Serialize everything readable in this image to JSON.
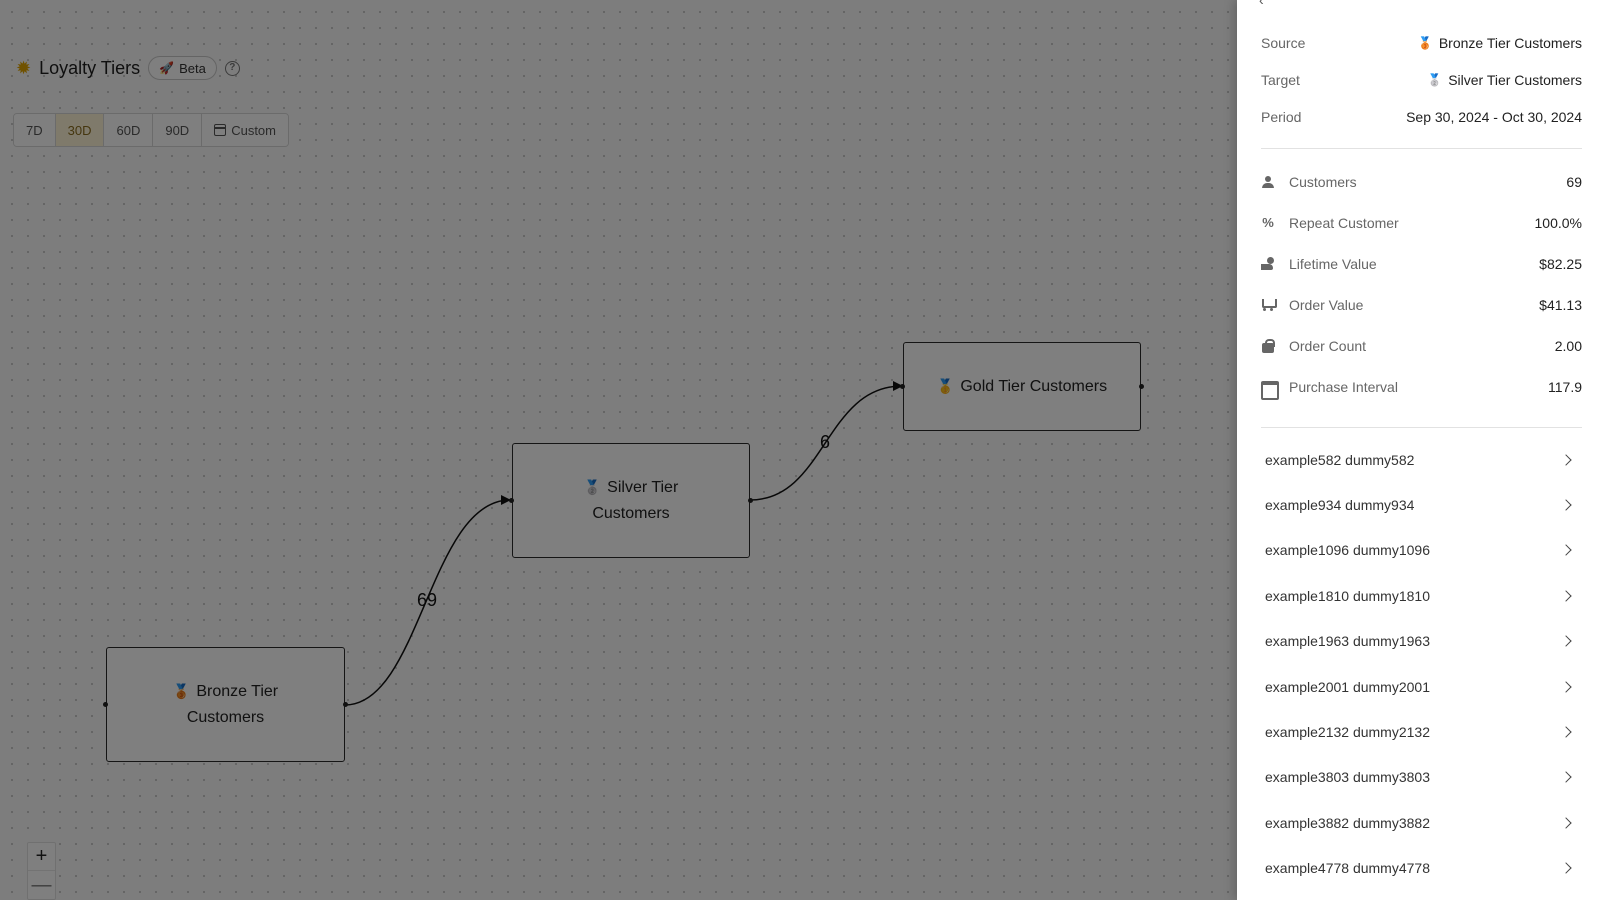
{
  "header": {
    "title": "Loyalty Tiers",
    "app_icon": "sun-icon",
    "badge_label": "Beta",
    "badge_icon": "rocket-icon",
    "help_icon": "help-circle-icon"
  },
  "periods": [
    {
      "label": "7D",
      "active": false
    },
    {
      "label": "30D",
      "active": true
    },
    {
      "label": "60D",
      "active": false
    },
    {
      "label": "90D",
      "active": false
    },
    {
      "label": "Custom",
      "active": false,
      "icon": "calendar-icon"
    }
  ],
  "flow": {
    "nodes": [
      {
        "id": "bronze",
        "line1": "Bronze Tier",
        "line2": "Customers",
        "medal": "🥉"
      },
      {
        "id": "silver",
        "line1": "Silver Tier",
        "line2": "Customers",
        "medal": "🥈"
      },
      {
        "id": "gold",
        "line1": "Gold Tier Customers",
        "medal": "🥇"
      }
    ],
    "edges": [
      {
        "from": "bronze",
        "to": "silver",
        "label": "69"
      },
      {
        "from": "silver",
        "to": "gold",
        "label": "6"
      }
    ]
  },
  "zoom": {
    "in_label": "+",
    "out_label": "—"
  },
  "panel": {
    "info": [
      {
        "label": "Source",
        "value": "Bronze Tier Customers",
        "medal": "🥉"
      },
      {
        "label": "Target",
        "value": "Silver Tier Customers",
        "medal": "🥈"
      },
      {
        "label": "Period",
        "value": "Sep 30, 2024 - Oct 30, 2024"
      }
    ],
    "metrics": [
      {
        "label": "Customers",
        "value": "69",
        "icon": "person-icon"
      },
      {
        "label": "Repeat Customer",
        "value": "100.0%",
        "icon": "percent-icon"
      },
      {
        "label": "Lifetime Value",
        "value": "$82.25",
        "icon": "hand-coin-icon"
      },
      {
        "label": "Order Value",
        "value": "$41.13",
        "icon": "cart-icon"
      },
      {
        "label": "Order Count",
        "value": "2.00",
        "icon": "bag-icon"
      },
      {
        "label": "Purchase Interval",
        "value": "117.9",
        "icon": "calendar-icon"
      }
    ],
    "customers": [
      "example582 dummy582",
      "example934 dummy934",
      "example1096 dummy1096",
      "example1810 dummy1810",
      "example1963 dummy1963",
      "example2001 dummy2001",
      "example2132 dummy2132",
      "example3803 dummy3803",
      "example3882 dummy3882",
      "example4778 dummy4778"
    ]
  }
}
